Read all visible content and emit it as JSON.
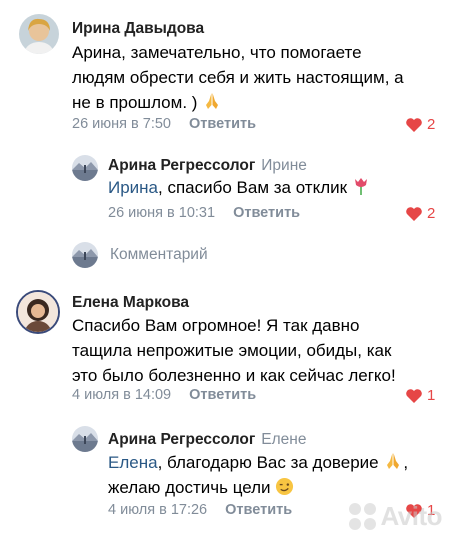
{
  "colors": {
    "link": "#2a5885",
    "meta": "#818c99",
    "like": "#e64646"
  },
  "comments": [
    {
      "author": "Ирина Давыдова",
      "reply_to": "",
      "lines": [
        "Арина, замечательно, что помогаете",
        "людям обрести себя и жить настоящим, а",
        "не в прошлом. )"
      ],
      "emoji": "pray-emoji",
      "date": "26 июня в 7:50",
      "reply_label": "Ответить",
      "likes": "2"
    },
    {
      "author": "Арина Регрессолог",
      "reply_to": "Ирине",
      "mention": "Ирина",
      "rest": ", спасибо Вам за отклик",
      "emoji": "tulip-emoji",
      "date": "26 июня в 10:31",
      "reply_label": "Ответить",
      "likes": "2"
    },
    {
      "author": "Елена Маркова",
      "reply_to": "",
      "lines": [
        "Спасибо Вам огромное! Я так давно",
        "тащила непрожитые эмоции, обиды, как",
        "это было болезненно и как сейчас легко!"
      ],
      "date": "4 июля в 14:09",
      "reply_label": "Ответить",
      "likes": "1"
    },
    {
      "author": "Арина Регрессолог",
      "reply_to": "Елене",
      "mention": "Елена",
      "rest": ", благодарю Вас за доверие",
      "line2": "желаю достичь цели",
      "emoji": "pray-emoji",
      "emoji2": "wink-emoji",
      "date": "4 июля в 17:26",
      "reply_label": "Ответить",
      "likes": "1"
    }
  ],
  "compose": {
    "label": "Комментарий"
  },
  "watermark": {
    "text": "Avito"
  }
}
